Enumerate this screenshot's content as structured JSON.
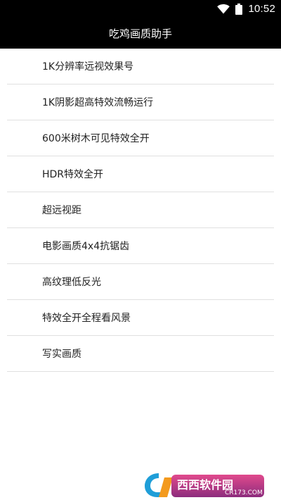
{
  "status_bar": {
    "time": "10:52",
    "icons": [
      "wifi-icon",
      "battery-icon"
    ]
  },
  "header": {
    "title": "吃鸡画质助手"
  },
  "menu": {
    "items": [
      {
        "label": "1K分辨率远视效果号"
      },
      {
        "label": "1K阴影超高特效流畅运行"
      },
      {
        "label": "600米树木可见特效全开"
      },
      {
        "label": "HDR特效全开"
      },
      {
        "label": "超远视距"
      },
      {
        "label": "电影画质4x4抗锯齿"
      },
      {
        "label": "高纹理低反光"
      },
      {
        "label": "特效全开全程看风景"
      },
      {
        "label": "写实画质"
      }
    ]
  },
  "watermark": {
    "brand": "西西软件园",
    "site": "CR173.COM"
  },
  "colors": {
    "bar_background": "#000000",
    "bar_text": "#ffffff",
    "divider": "#e0e0e0",
    "item_text": "#222222"
  }
}
